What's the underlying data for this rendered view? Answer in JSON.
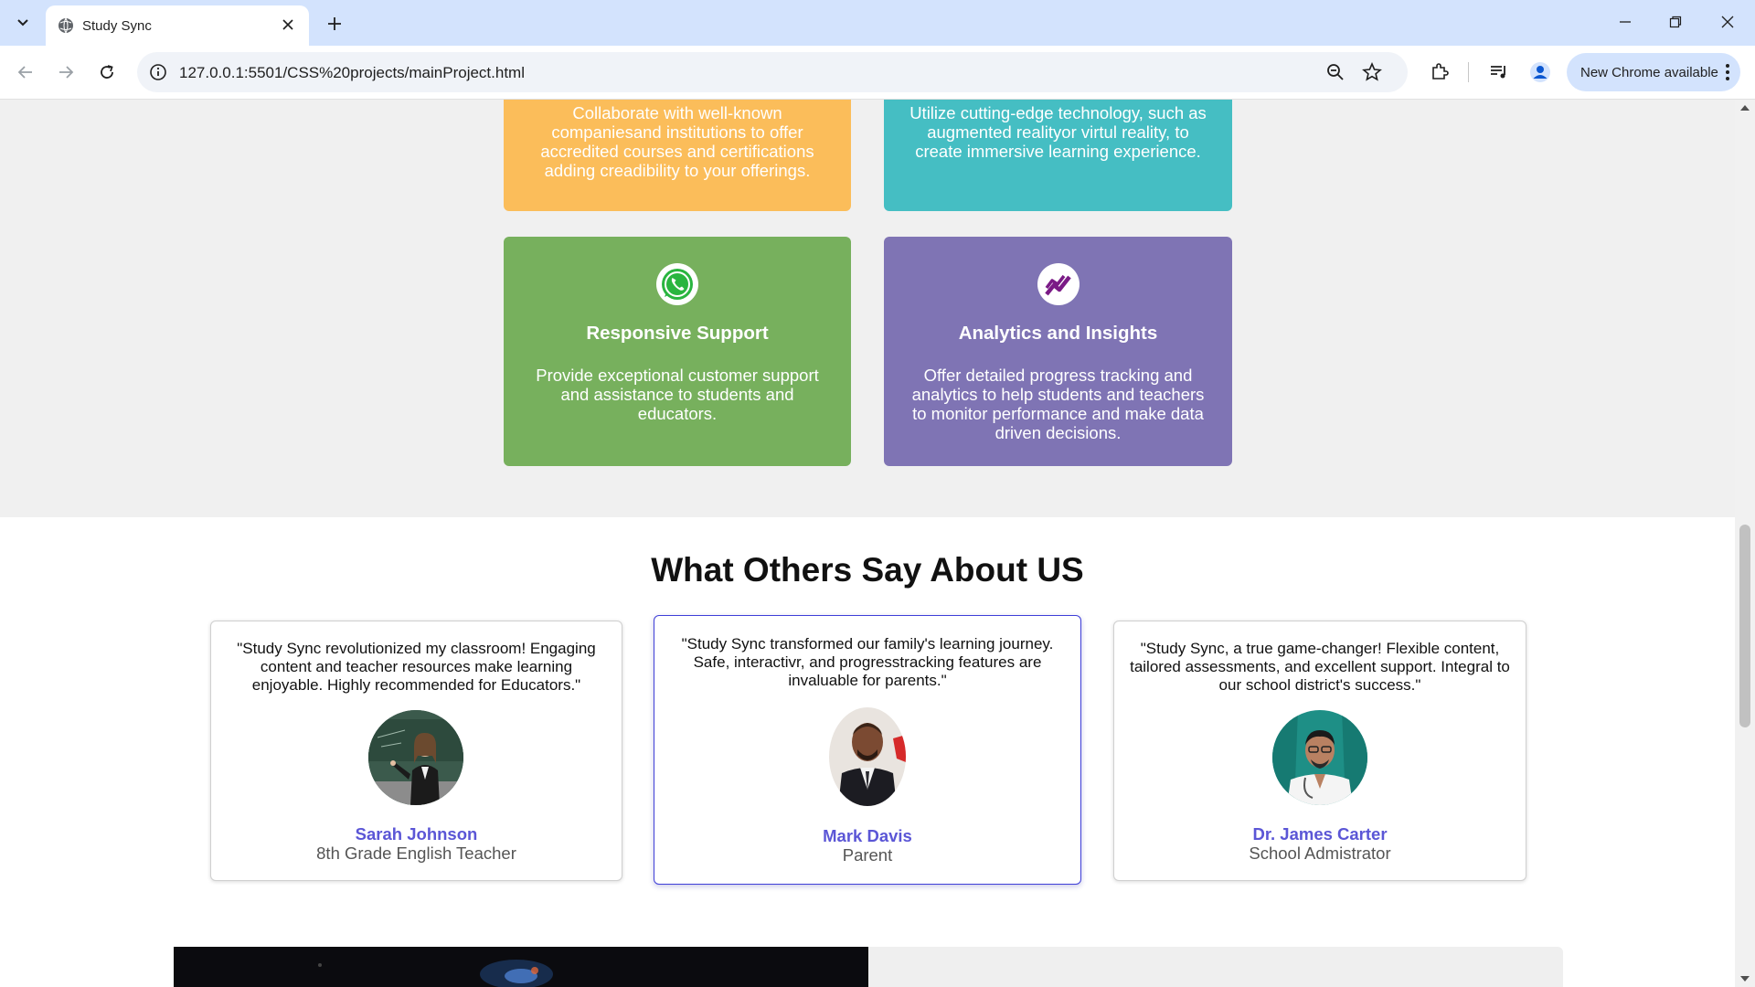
{
  "browser": {
    "tab_title": "Study Sync",
    "url": "127.0.0.1:5501/CSS%20projects/mainProject.html",
    "update_label": "New Chrome available"
  },
  "features": {
    "cards": [
      {
        "title": "",
        "text": "Collaborate with well-known companiesand institutions to offer accredited courses and certifications adding creadibility to your offerings.",
        "color": "#fbbd5a"
      },
      {
        "title": "",
        "text": "Utilize cutting-edge technology, such as augmented realityor virtul reality, to create immersive learning experience.",
        "color": "#45bec3"
      },
      {
        "title": "Responsive Support",
        "text": "Provide exceptional customer support and assistance to students and educators.",
        "color": "#77b05d",
        "icon": "whatsapp-icon"
      },
      {
        "title": "Analytics and Insights",
        "text": "Offer detailed progress tracking and analytics to help students and teachers to monitor performance and make data driven decisions.",
        "color": "#7f74b4",
        "icon": "trend-chart-icon"
      }
    ]
  },
  "testimonials": {
    "heading": "What Others Say About US",
    "items": [
      {
        "quote": "\"Study Sync revolutionized my classroom! Engaging content and teacher resources make learning enjoyable. Highly recommended for Educators.\"",
        "name": "Sarah Johnson",
        "role": "8th Grade English Teacher"
      },
      {
        "quote": "\"Study Sync transformed our family's learning journey. Safe, interactivr, and progresstracking features are invaluable for parents.\"",
        "name": "Mark Davis",
        "role": "Parent"
      },
      {
        "quote": "\"Study Sync, a true game-changer! Flexible content, tailored assessments, and excellent support. Integral to our school district's success.\"",
        "name": "Dr. James Carter",
        "role": "School Admistrator"
      }
    ]
  },
  "colors": {
    "accent_name": "#5b56d6",
    "active_border": "#3f3fd8"
  }
}
